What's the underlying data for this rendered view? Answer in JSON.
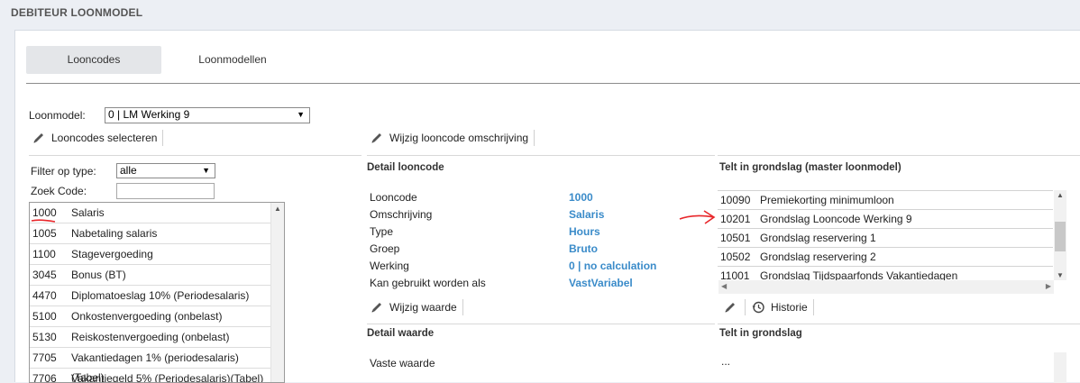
{
  "page": {
    "title": "DEBITEUR LOONMODEL"
  },
  "tabs": {
    "looncodes": "Looncodes",
    "loonmodellen": "Loonmodellen"
  },
  "loonmodel": {
    "label": "Loonmodel:",
    "value": "0 | LM Werking 9"
  },
  "left": {
    "select_button": "Looncodes selecteren",
    "filter_label": "Filter op type:",
    "filter_value": "alle",
    "zoek_label": "Zoek Code:",
    "zoek_value": "",
    "items": [
      {
        "code": "1000",
        "desc": "Salaris"
      },
      {
        "code": "1005",
        "desc": "Nabetaling salaris"
      },
      {
        "code": "1100",
        "desc": "Stagevergoeding"
      },
      {
        "code": "3045",
        "desc": "Bonus (BT)"
      },
      {
        "code": "4470",
        "desc": "Diplomatoeslag 10% (Periodesalaris)"
      },
      {
        "code": "5100",
        "desc": "Onkostenvergoeding (onbelast)"
      },
      {
        "code": "5130",
        "desc": "Reiskostenvergoeding (onbelast)"
      },
      {
        "code": "7705",
        "desc": "Vakantiedagen 1% (periodesalaris)(Tabel)"
      },
      {
        "code": "7706",
        "desc": "Vakantiegeld 5% (Periodesalaris)(Tabel)"
      }
    ]
  },
  "middle": {
    "edit_button": "Wijzig looncode omschrijving",
    "detail_title": "Detail looncode",
    "details": [
      {
        "key": "Looncode",
        "value": "1000"
      },
      {
        "key": "Omschrijving",
        "value": "Salaris"
      },
      {
        "key": "Type",
        "value": "Hours"
      },
      {
        "key": "Groep",
        "value": "Bruto"
      },
      {
        "key": "Werking",
        "value": "0 | no calculation"
      },
      {
        "key": "Kan gebruikt worden als",
        "value": "VastVariabel"
      }
    ],
    "wijzig_waarde": "Wijzig waarde",
    "detail_waarde_title": "Detail waarde",
    "vaste_waarde_label": "Vaste waarde"
  },
  "right": {
    "grondslag_master_title": "Telt in grondslag (master loonmodel)",
    "items": [
      {
        "code": "10090",
        "desc": "Premiekorting minimumloon"
      },
      {
        "code": "10201",
        "desc": "Grondslag Looncode Werking 9"
      },
      {
        "code": "10501",
        "desc": "Grondslag reservering 1"
      },
      {
        "code": "10502",
        "desc": "Grondslag reservering 2"
      },
      {
        "code": "11001",
        "desc": "Grondslag Tijdspaarfonds Vakantiedagen"
      }
    ],
    "historie": "Historie",
    "grondslag_title": "Telt in grondslag",
    "grondslag_value": "..."
  },
  "colors": {
    "link_blue": "#3a8bc9",
    "annotation_red": "#e8262a"
  },
  "icons": [
    "pencil-icon",
    "history-icon",
    "dropdown-arrow-icon",
    "scroll-arrow-icon"
  ]
}
